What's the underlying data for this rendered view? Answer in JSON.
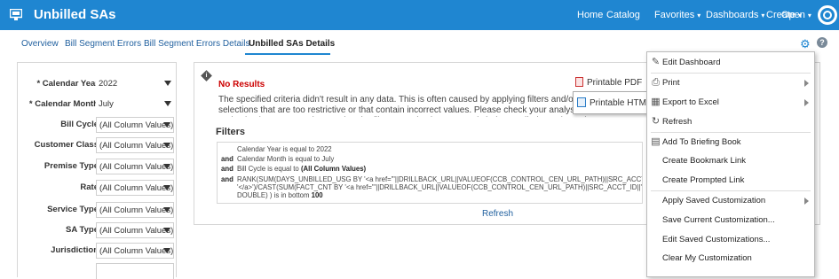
{
  "app": {
    "title": "Unbilled SAs",
    "nav": {
      "home": "Home",
      "catalog": "Catalog",
      "favorites": "Favorites",
      "dashboards": "Dashboards",
      "create": "Create",
      "open": "Open"
    },
    "caret": "▾"
  },
  "tabs": [
    {
      "label": "Overview"
    },
    {
      "label": "Bill Segment Errors"
    },
    {
      "label": "Bill Segment Errors Details"
    },
    {
      "label": "Unbilled SAs Details"
    }
  ],
  "toolbar": {
    "help": "?"
  },
  "prompts": [
    {
      "label": "* Calendar Year",
      "value": "2022"
    },
    {
      "label": "* Calendar Month",
      "value": "July"
    },
    {
      "label": "Bill Cycle",
      "value": "(All Column Values)"
    },
    {
      "label": "Customer Class",
      "value": "(All Column Values)"
    },
    {
      "label": "Premise Type",
      "value": "(All Column Values)"
    },
    {
      "label": "Rate",
      "value": "(All Column Values)"
    },
    {
      "label": "Service Type",
      "value": "(All Column Values)"
    },
    {
      "label": "SA Type",
      "value": "(All Column Values)"
    },
    {
      "label": "Jurisdiction",
      "value": "(All Column Values)"
    }
  ],
  "results": {
    "heading": "No Results",
    "message": "The specified criteria didn't result in any data. This is often caused by applying filters and/or selections that are too restrictive or that contain incorrect values. Please check your analysis filters and selection steps, and try again. The filters or selections currently being applied are shown here.",
    "printable_pdf": "Printable PDF",
    "printable_html": "Printable HTML",
    "filters_heading": "Filters",
    "filters": [
      {
        "conj": "",
        "text": "Calendar Year is equal to 2022"
      },
      {
        "conj": "and",
        "text": "Calendar Month is equal to July"
      },
      {
        "conj": "and",
        "text": "Bill Cycle is equal to ",
        "bold": "(All Column Values)"
      },
      {
        "conj": "and",
        "text": "RANK(SUM(DAYS_UNBILLED_USG BY '<a href=\"'||DRILLBACK_URL||VALUEOF(CCB_CONTROL_CEN_URL_PATH)||SRC_ACCT"
      },
      {
        "conj": "",
        "text": "'</a>')/CAST(SUM(FACT_CNT BY '<a href=\"'||DRILLBACK_URL||VALUEOF(CCB_CONTROL_CEN_URL_PATH)||SRC_ACCT_ID||'"
      },
      {
        "conj": "",
        "text": "DOUBLE) ) is in bottom ",
        "bold": "100"
      }
    ],
    "refresh": "Refresh"
  },
  "menu": {
    "items": [
      {
        "label": "Edit Dashboard",
        "icon": "pencil-icon",
        "glyph": "✎",
        "submenu": false
      },
      {
        "label": "Print",
        "icon": "printer-icon",
        "glyph": "⎙",
        "submenu": true
      },
      {
        "label": "Export to Excel",
        "icon": "excel-icon",
        "glyph": "▦",
        "submenu": true
      },
      {
        "label": "Refresh",
        "icon": "refresh-icon",
        "glyph": "↻",
        "submenu": false
      },
      {
        "label": "Add To Briefing Book",
        "icon": "book-icon",
        "glyph": "▤",
        "submenu": false
      },
      {
        "label": "Create Bookmark Link",
        "icon": "",
        "glyph": "",
        "submenu": false
      },
      {
        "label": "Create Prompted Link",
        "icon": "",
        "glyph": "",
        "submenu": false
      },
      {
        "label": "Apply Saved Customization",
        "icon": "",
        "glyph": "",
        "submenu": true
      },
      {
        "label": "Save Current Customization...",
        "icon": "",
        "glyph": "",
        "submenu": false
      },
      {
        "label": "Edit Saved Customizations...",
        "icon": "",
        "glyph": "",
        "submenu": false
      },
      {
        "label": "Clear My Customization",
        "icon": "",
        "glyph": "",
        "submenu": false
      }
    ]
  },
  "colors": {
    "header_bg": "#1f86d1",
    "link": "#1f5f9e",
    "error": "#cc0000"
  }
}
